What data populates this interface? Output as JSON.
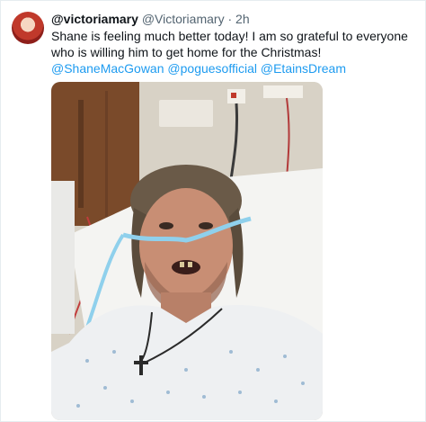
{
  "tweet": {
    "display_name": "@victoriamary",
    "handle": "@Victoriamary",
    "separator": "·",
    "time": "2h",
    "text_line1": "Shane is feeling much better today! I am so grateful to everyone who is willing him to get home for the Christmas!",
    "mentions": [
      "@ShaneMacGowan",
      "@poguesofficial",
      "@EtainsDream"
    ]
  },
  "colors": {
    "link": "#1d9bf0",
    "text": "#0f1419",
    "secondary": "#536471"
  },
  "icons": {
    "avatar": "profile-avatar"
  }
}
